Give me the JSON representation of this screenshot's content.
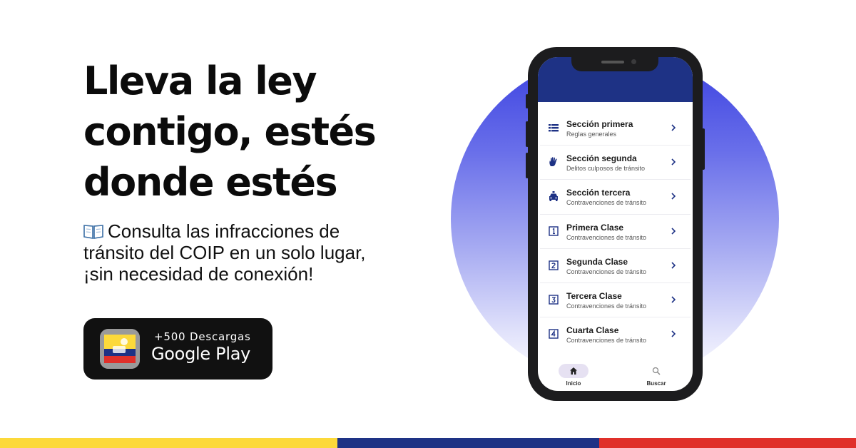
{
  "hero": {
    "headline_lines": [
      "Lleva la ley",
      "contigo, estés",
      "donde estés"
    ],
    "subtext": "Consulta las infracciones de tránsito del COIP en un solo lugar, ¡sin necesidad de conexión!",
    "subtext_icon": "open-book-icon"
  },
  "badge": {
    "downloads": "+500 Descargas",
    "store": "Google Play"
  },
  "app": {
    "menu": [
      {
        "title": "Sección primera",
        "subtitle": "Reglas generales",
        "icon": "list-icon"
      },
      {
        "title": "Sección segunda",
        "subtitle": "Delitos culposos de tránsito",
        "icon": "hand-icon"
      },
      {
        "title": "Sección tercera",
        "subtitle": "Contravenciones de tránsito",
        "icon": "police-car-icon"
      },
      {
        "title": "Primera Clase",
        "subtitle": "Contravenciones de tránsito",
        "icon": "number-1-icon"
      },
      {
        "title": "Segunda Clase",
        "subtitle": "Contravenciones de tránsito",
        "icon": "number-2-icon"
      },
      {
        "title": "Tercera Clase",
        "subtitle": "Contravenciones de tránsito",
        "icon": "number-3-icon"
      },
      {
        "title": "Cuarta Clase",
        "subtitle": "Contravenciones de tránsito",
        "icon": "number-4-icon"
      }
    ],
    "nav": {
      "home": "Inicio",
      "search": "Buscar"
    }
  },
  "colors": {
    "app_header": "#1e3285",
    "accent_circle": "#3a40e0",
    "flag_yellow": "#fcd93a",
    "flag_blue": "#1e3285",
    "flag_red": "#e0302a"
  }
}
